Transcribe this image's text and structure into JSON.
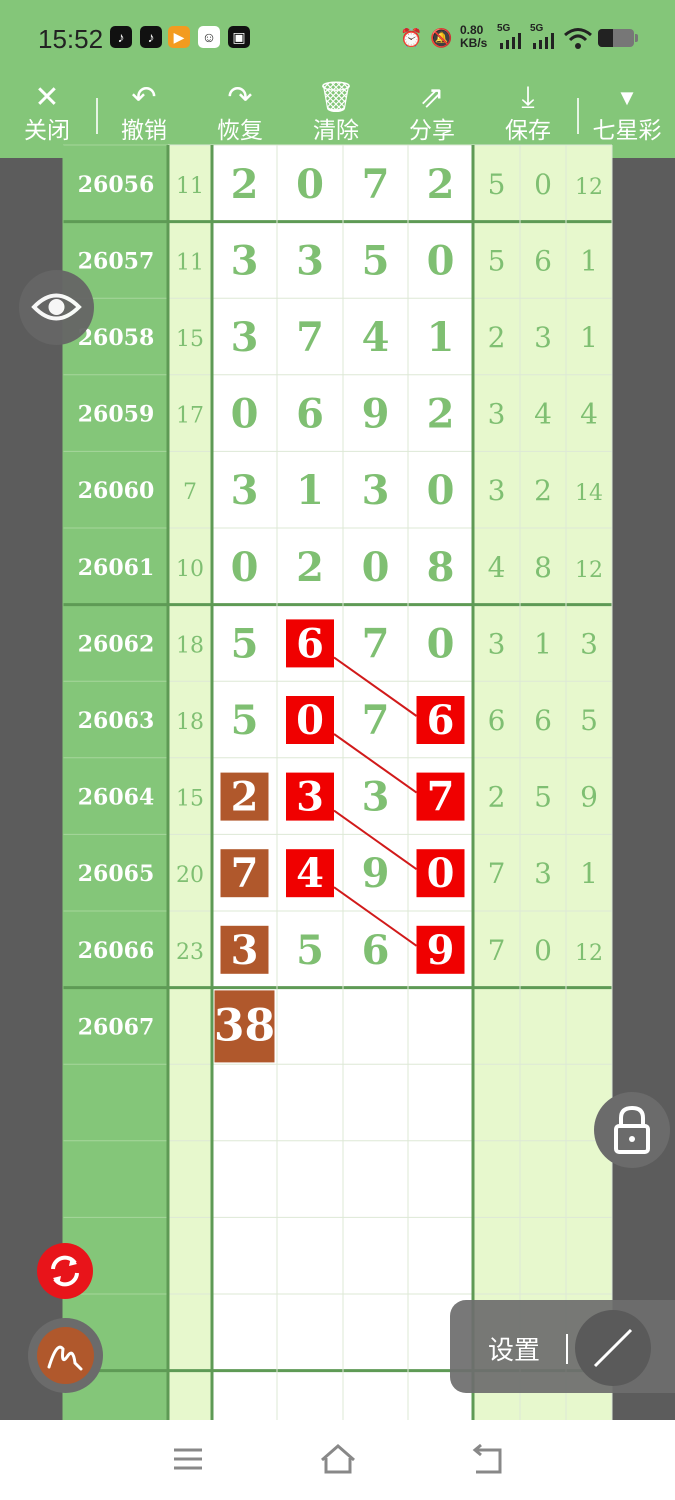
{
  "status_bar": {
    "time": "15:52",
    "net_speed": "0.80",
    "net_unit": "KB/s",
    "signal1": "5G",
    "signal2": "5G"
  },
  "toolbar": {
    "close": "关闭",
    "undo": "撤销",
    "redo": "恢复",
    "clear": "清除",
    "share": "分享",
    "save": "保存",
    "lottery": "七星彩"
  },
  "table": {
    "rows": [
      {
        "period": "26056",
        "sum": "11",
        "d": [
          "2",
          "0",
          "7",
          "2"
        ],
        "r": [
          "5",
          "0",
          "12"
        ]
      },
      {
        "period": "26057",
        "sum": "11",
        "d": [
          "3",
          "3",
          "5",
          "0"
        ],
        "r": [
          "5",
          "6",
          "1"
        ]
      },
      {
        "period": "26058",
        "sum": "15",
        "d": [
          "3",
          "7",
          "4",
          "1"
        ],
        "r": [
          "2",
          "3",
          "1"
        ]
      },
      {
        "period": "26059",
        "sum": "17",
        "d": [
          "0",
          "6",
          "9",
          "2"
        ],
        "r": [
          "3",
          "4",
          "4"
        ]
      },
      {
        "period": "26060",
        "sum": "7",
        "d": [
          "3",
          "1",
          "3",
          "0"
        ],
        "r": [
          "3",
          "2",
          "14"
        ]
      },
      {
        "period": "26061",
        "sum": "10",
        "d": [
          "0",
          "2",
          "0",
          "8"
        ],
        "r": [
          "4",
          "8",
          "12"
        ]
      },
      {
        "period": "26062",
        "sum": "18",
        "d": [
          "5",
          "6",
          "7",
          "0"
        ],
        "r": [
          "3",
          "1",
          "3"
        ]
      },
      {
        "period": "26063",
        "sum": "18",
        "d": [
          "5",
          "0",
          "7",
          "6"
        ],
        "r": [
          "6",
          "6",
          "5"
        ]
      },
      {
        "period": "26064",
        "sum": "15",
        "d": [
          "2",
          "3",
          "3",
          "7"
        ],
        "r": [
          "2",
          "5",
          "9"
        ]
      },
      {
        "period": "26065",
        "sum": "20",
        "d": [
          "7",
          "4",
          "9",
          "0"
        ],
        "r": [
          "7",
          "3",
          "1"
        ]
      },
      {
        "period": "26066",
        "sum": "23",
        "d": [
          "3",
          "5",
          "6",
          "9"
        ],
        "r": [
          "7",
          "0",
          "12"
        ]
      },
      {
        "period": "26067",
        "sum": "",
        "d": [
          "38",
          "",
          "",
          ""
        ],
        "r": [
          "",
          "",
          ""
        ]
      }
    ],
    "highlights": [
      {
        "row": 6,
        "col": 1,
        "color": "red"
      },
      {
        "row": 7,
        "col": 1,
        "color": "red"
      },
      {
        "row": 7,
        "col": 3,
        "color": "red"
      },
      {
        "row": 8,
        "col": 0,
        "color": "brown"
      },
      {
        "row": 8,
        "col": 1,
        "color": "red"
      },
      {
        "row": 8,
        "col": 3,
        "color": "red"
      },
      {
        "row": 9,
        "col": 0,
        "color": "brown"
      },
      {
        "row": 9,
        "col": 1,
        "color": "red"
      },
      {
        "row": 9,
        "col": 3,
        "color": "red"
      },
      {
        "row": 10,
        "col": 0,
        "color": "brown"
      },
      {
        "row": 10,
        "col": 3,
        "color": "red"
      },
      {
        "row": 11,
        "col": 0,
        "color": "brown"
      }
    ],
    "connectors": [
      {
        "from": [
          6,
          1
        ],
        "to": [
          7,
          3
        ]
      },
      {
        "from": [
          7,
          1
        ],
        "to": [
          8,
          3
        ]
      },
      {
        "from": [
          8,
          1
        ],
        "to": [
          9,
          3
        ]
      },
      {
        "from": [
          9,
          1
        ],
        "to": [
          10,
          3
        ]
      }
    ]
  },
  "settings": {
    "label": "设置"
  },
  "colors": {
    "green": "#84c679",
    "dark_green_line": "#5e9a55",
    "light_green": "#e7f8cd",
    "digit_green": "#7fbf72",
    "red": "#f00000",
    "brown": "#b0582c",
    "gray": "#5c5c5c"
  },
  "icons": [
    "close-icon",
    "undo-icon",
    "redo-icon",
    "clear-icon",
    "share-icon",
    "download-icon",
    "dropdown-icon",
    "eye-icon",
    "lock-icon",
    "refresh-icon",
    "pen-icon",
    "line-tool-icon",
    "menu-icon",
    "home-icon",
    "back-icon"
  ]
}
